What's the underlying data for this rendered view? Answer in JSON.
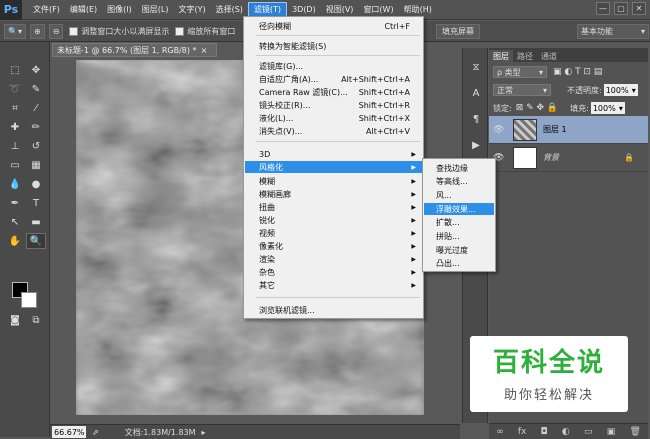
{
  "app": {
    "logo": "Ps"
  },
  "menubar": {
    "items": [
      "文件(F)",
      "编辑(E)",
      "图像(I)",
      "图层(L)",
      "文字(Y)",
      "选择(S)",
      "滤镜(T)",
      "3D(D)",
      "视图(V)",
      "窗口(W)",
      "帮助(H)"
    ],
    "active_index": 6
  },
  "window_controls": {
    "minimize": "—",
    "maximize": "▢",
    "close": "✕"
  },
  "options": {
    "resize_label": "调整窗口大小以满屏显示",
    "zoom_all_label": "缩放所有窗口",
    "fill_screen_label": "填充屏幕",
    "workspace_value": "基本功能"
  },
  "document": {
    "tab_title": "未标题-1 @ 66.7% (图层 1, RGB/8) *",
    "tab_close": "×"
  },
  "status": {
    "zoom": "66.67%",
    "doc_info": "文档:1.83M/1.83M"
  },
  "filter_menu": {
    "items": [
      {
        "label": "径向模糊",
        "shortcut": "Ctrl+F"
      },
      {
        "label": "转换为智能滤镜(S)",
        "shortcut": ""
      },
      {
        "label": "滤镜库(G)...",
        "shortcut": ""
      },
      {
        "label": "自适应广角(A)...",
        "shortcut": "Alt+Shift+Ctrl+A"
      },
      {
        "label": "Camera Raw 滤镜(C)...",
        "shortcut": "Shift+Ctrl+A"
      },
      {
        "label": "镜头校正(R)...",
        "shortcut": "Shift+Ctrl+R"
      },
      {
        "label": "液化(L)...",
        "shortcut": "Shift+Ctrl+X"
      },
      {
        "label": "消失点(V)...",
        "shortcut": "Alt+Ctrl+V"
      },
      {
        "label": "3D",
        "shortcut": ""
      },
      {
        "label": "风格化",
        "shortcut": ""
      },
      {
        "label": "模糊",
        "shortcut": ""
      },
      {
        "label": "模糊画廊",
        "shortcut": ""
      },
      {
        "label": "扭曲",
        "shortcut": ""
      },
      {
        "label": "锐化",
        "shortcut": ""
      },
      {
        "label": "视频",
        "shortcut": ""
      },
      {
        "label": "像素化",
        "shortcut": ""
      },
      {
        "label": "渲染",
        "shortcut": ""
      },
      {
        "label": "杂色",
        "shortcut": ""
      },
      {
        "label": "其它",
        "shortcut": ""
      },
      {
        "label": "浏览联机滤镜...",
        "shortcut": ""
      }
    ],
    "highlighted_index": 9
  },
  "stylize_submenu": {
    "items": [
      "查找边缘",
      "等高线...",
      "风...",
      "浮雕效果...",
      "扩散...",
      "拼贴...",
      "曝光过度",
      "凸出..."
    ],
    "highlighted_index": 3
  },
  "layers_panel": {
    "tabs": [
      "图层",
      "路径",
      "通道"
    ],
    "kind_label": "ρ 类型",
    "blend_mode": "正常",
    "opacity_label": "不透明度:",
    "opacity_value": "100%",
    "lock_label": "锁定:",
    "fill_label": "填充:",
    "fill_value": "100%",
    "layers": [
      {
        "name": "图层 1",
        "selected": true
      },
      {
        "name": "背景",
        "selected": false
      }
    ],
    "footer_icons": [
      "link-icon",
      "fx-icon",
      "mask-icon",
      "adjustment-icon",
      "folder-icon",
      "new-layer-icon",
      "trash-icon"
    ]
  },
  "watermark": {
    "title": "百科全说",
    "subtitle": "助你轻松解决"
  }
}
